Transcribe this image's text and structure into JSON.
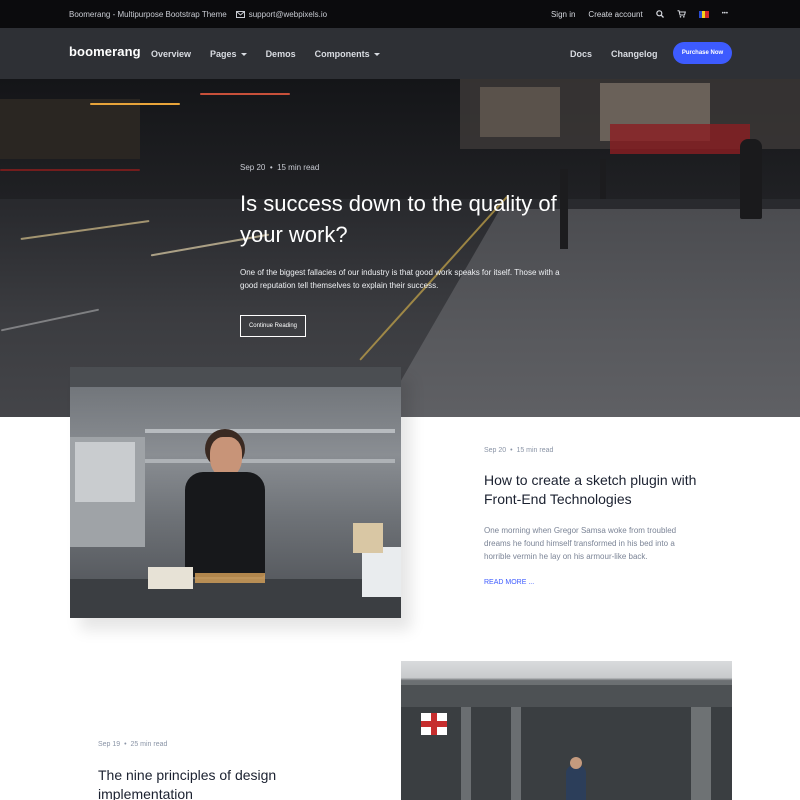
{
  "topbar": {
    "site": "Boomerang - Multipurpose Bootstrap Theme",
    "email": "support@webpixels.io",
    "signin": "Sign in",
    "create": "Create account",
    "more": "•••"
  },
  "nav": {
    "logo": "boomerang",
    "items": [
      "Overview",
      "Pages",
      "Demos",
      "Components"
    ],
    "right_items": [
      "Docs",
      "Changelog"
    ],
    "purchase": "Purchase Now"
  },
  "hero": {
    "date": "Sep 20",
    "read": "15 min read",
    "title": "Is success down to the quality of your work?",
    "text": "One of the biggest fallacies of our industry is that good work speaks for itself. Those with a good reputation tell themselves to explain their success.",
    "button": "Continue Reading"
  },
  "posts": [
    {
      "date": "Sep 20",
      "read": "15 min read",
      "title": "How to create a sketch plugin with Front-End Technologies",
      "excerpt": "One morning when Gregor Samsa woke from troubled dreams he found himself transformed in his bed into a horrible vermin he lay on his armour-like back.",
      "more": "READ MORE ..."
    },
    {
      "date": "Sep 19",
      "read": "25 min read",
      "title": "The nine principles of design implementation"
    }
  ],
  "colors": {
    "accent": "#3d5bff",
    "topbar": "#0b0b0d",
    "nav": "#2e3035"
  },
  "icons": [
    "mail-icon",
    "search-icon",
    "cart-icon",
    "flag-icon"
  ]
}
